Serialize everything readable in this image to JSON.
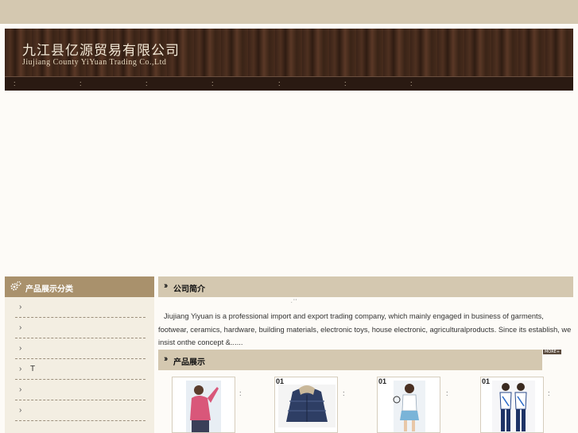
{
  "header": {
    "company_cn": "九江县亿源贸易有限公司",
    "company_en": "Jiujiang County YiYuan Trading Co.,Ltd"
  },
  "nav": {
    "separator": ":"
  },
  "sidebar": {
    "title": "产品展示分类",
    "items": [
      {
        "label": ""
      },
      {
        "label": ""
      },
      {
        "label": ""
      },
      {
        "label": "T"
      },
      {
        "label": ""
      },
      {
        "label": ""
      }
    ]
  },
  "about": {
    "title": "公司简介",
    "marks": ".  '  '",
    "text": "Jiujiang Yiyuan is a professional import and export trading company, which mainly engaged in business of garments, footwear, ceramics, hardware, building materials, electronic toys, house electronic, agriculturalproducts. Since its establish, we insist onthe concept &......"
  },
  "products": {
    "title": "产品展示",
    "more_label": "MORE+",
    "items": [
      {
        "num": "",
        "image": "pink-jacket-woman-photo"
      },
      {
        "num": "01",
        "image": "navy-down-jacket-photo"
      },
      {
        "num": "01",
        "image": "tennis-outfit-woman-photo"
      },
      {
        "num": "01",
        "image": "sports-uniform-couple-photo"
      }
    ]
  },
  "colors": {
    "top_band": "#d4c8b0",
    "header_wood": "#3b2418",
    "sidebar_head": "#a9916c",
    "section_bar": "#d4c8b0"
  }
}
